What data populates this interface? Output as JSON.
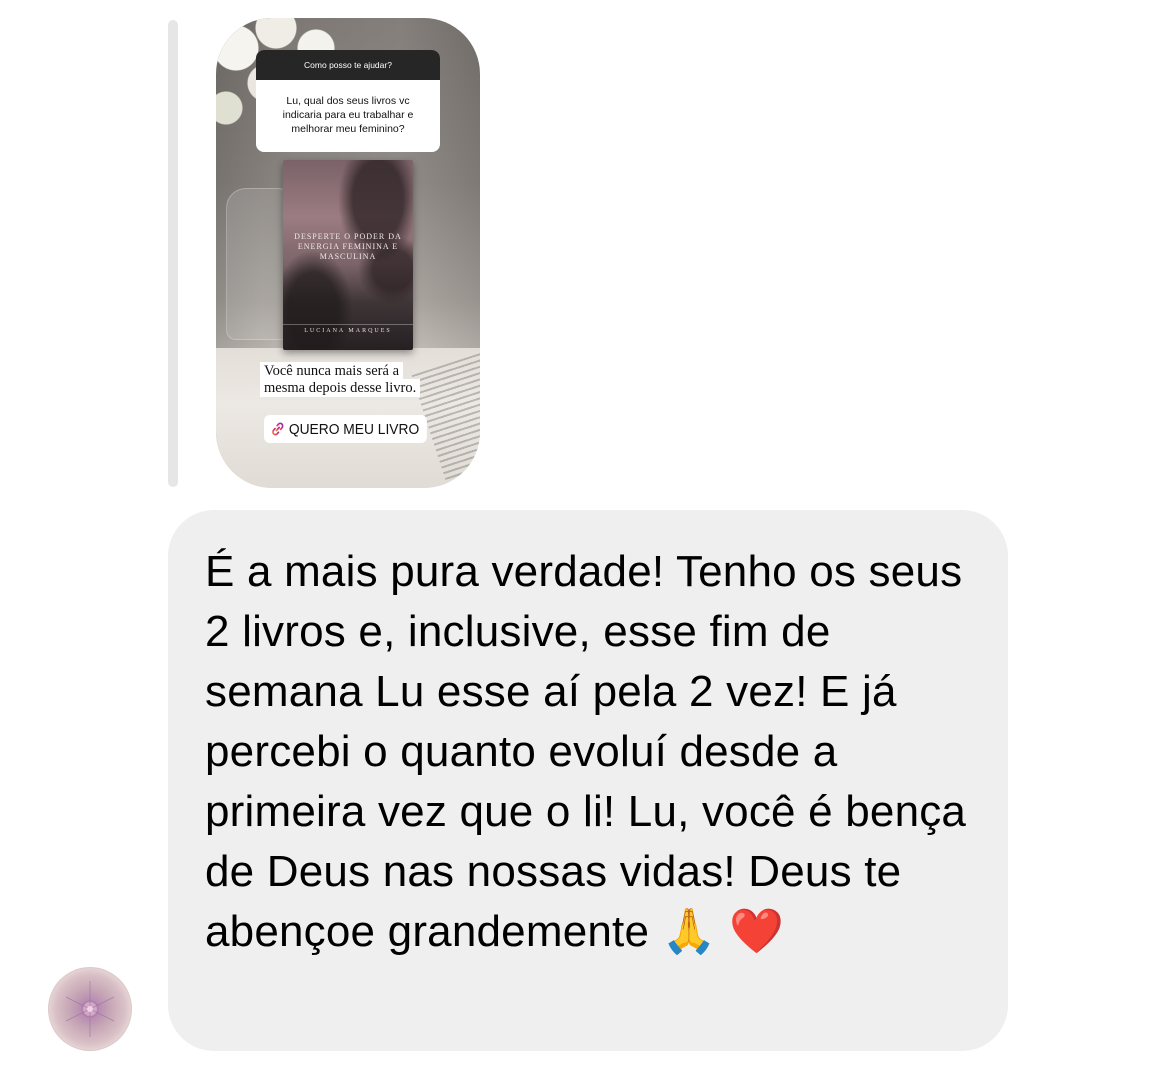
{
  "story_reply": {
    "question_header": "Como posso te ajudar?",
    "question_text": "Lu, qual dos seus livros  vc indicaria para eu trabalhar e melhorar  meu feminino?",
    "book": {
      "title": "DESPERTE O PODER DA ENERGIA FEMININA E MASCULINA",
      "author": "LUCIANA MARQUES"
    },
    "caption": "Você nunca mais será a mesma depois desse livro.",
    "link_label": "QUERO MEU LIVRO"
  },
  "message": {
    "text": "É a mais pura verdade! Tenho os seus 2 livros e, inclusive, esse fim de semana Lu esse aí pela 2 vez! E já percebi o quanto evoluí desde a primeira vez que o li! Lu, você é bença de Deus nas nossas vidas! Deus te abençoe grandemente 🙏 ❤️"
  },
  "icons": {
    "link": "link-icon",
    "avatar": "avatar"
  },
  "colors": {
    "bubble": "#efefef",
    "reply_bar": "#e6e6e6",
    "question_header": "#262626"
  }
}
